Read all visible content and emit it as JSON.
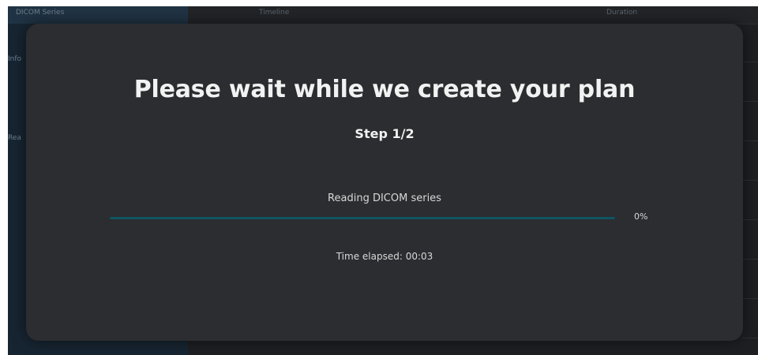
{
  "background": {
    "sidebar_title": "DICOM Series",
    "side_labels": [
      "Info",
      "Rea"
    ],
    "columns": [
      "Timeline",
      "Duration"
    ]
  },
  "modal": {
    "title": "Please wait while we create your plan",
    "step": "Step 1/2",
    "task_label": "Reading DICOM series",
    "progress_percent": 0,
    "progress_label": "0%",
    "elapsed": "Time elapsed: 00:03"
  },
  "colors": {
    "modal_bg": "#2b2d30",
    "progress_track": "#0f5463",
    "progress_fill": "#19a5c4",
    "text_primary": "#f2f2f2"
  }
}
